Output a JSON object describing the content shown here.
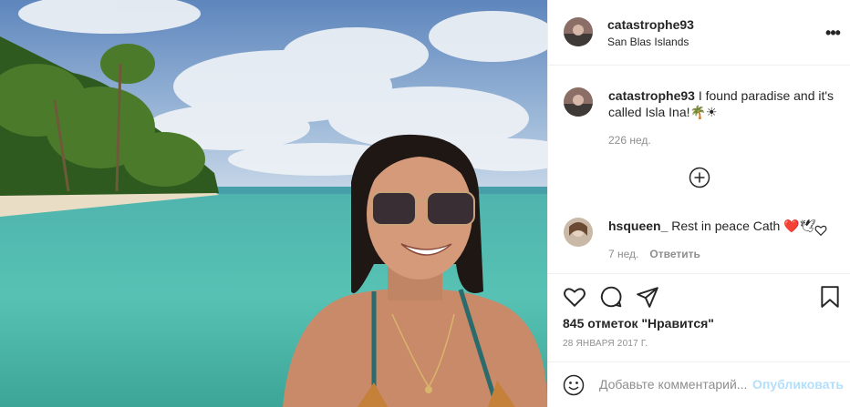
{
  "post": {
    "username": "catastrophe93",
    "location": "San Blas Islands",
    "more_icon": "more-horizontal-icon"
  },
  "caption": {
    "username": "catastrophe93",
    "text": " I found paradise and it's called Isla Ina!🌴☀",
    "time": "226 нед."
  },
  "load_more_icon": "plus-circle-icon",
  "comments": [
    {
      "username": "hsqueen_",
      "text": " Rest in peace Cath ❤️🕊",
      "time": "7 нед.",
      "reply_label": "Ответить"
    }
  ],
  "actions": {
    "icons": [
      "heart-icon",
      "comment-icon",
      "share-icon",
      "bookmark-icon"
    ],
    "likes_text": "845 отметок \"Нравится\"",
    "date": "28 ЯНВАРЯ 2017 Г."
  },
  "add_comment": {
    "placeholder": "Добавьте комментарий...",
    "publish_label": "Опубликовать"
  },
  "colors": {
    "text": "#262626",
    "secondary": "#8e8e8e",
    "publish_disabled": "#b2dffc",
    "border": "#efefef"
  }
}
